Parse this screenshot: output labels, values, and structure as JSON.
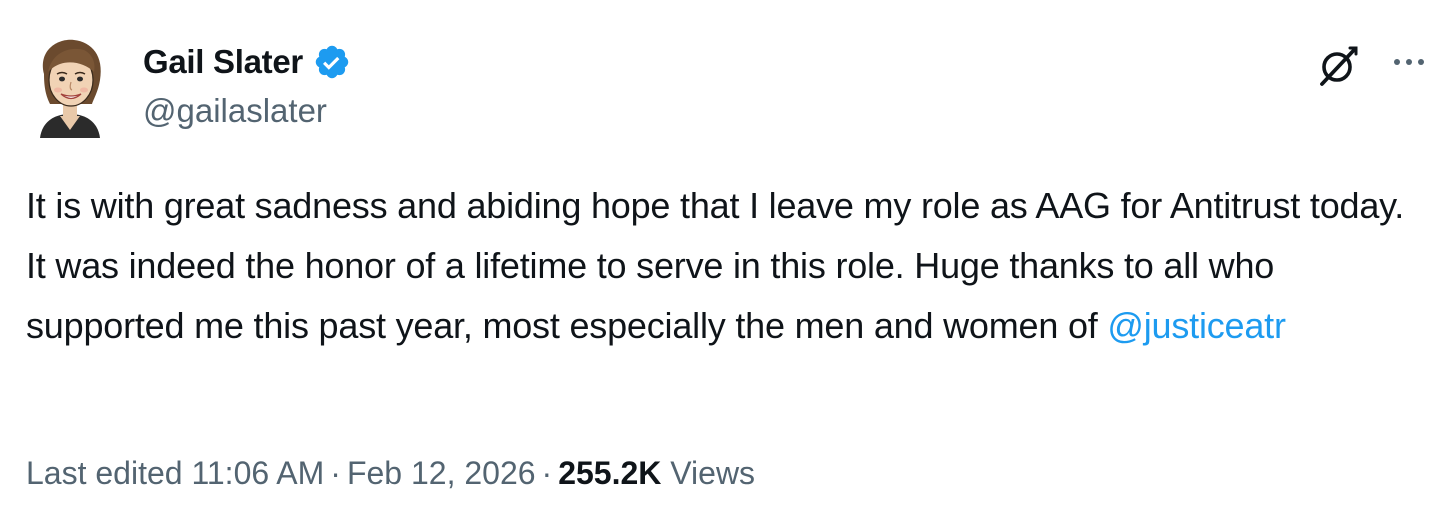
{
  "author": {
    "name": "Gail Slater",
    "handle": "@gailaslater",
    "verified_color": "#1d9bf0",
    "avatar": "cartoon-portrait-avatar"
  },
  "tweet": {
    "text_main": "It is with great sadness and abiding hope that I leave my role as AAG for Antitrust today. It was indeed the honor of a lifetime to serve in this role. Huge thanks to all who supported me this past year, most especially the men and women of ",
    "mention": "@justiceatr"
  },
  "meta": {
    "edited_label": "Last edited",
    "time": "11:06 AM",
    "separator": "·",
    "date": "Feb 12, 2026",
    "views_count": "255.2K",
    "views_label": "Views"
  },
  "icons": {
    "grok": "grok-icon",
    "more": "more-icon",
    "verified": "verified-badge-icon"
  },
  "colors": {
    "text": "#0f1419",
    "secondary": "#536471",
    "link": "#1d9bf0"
  }
}
